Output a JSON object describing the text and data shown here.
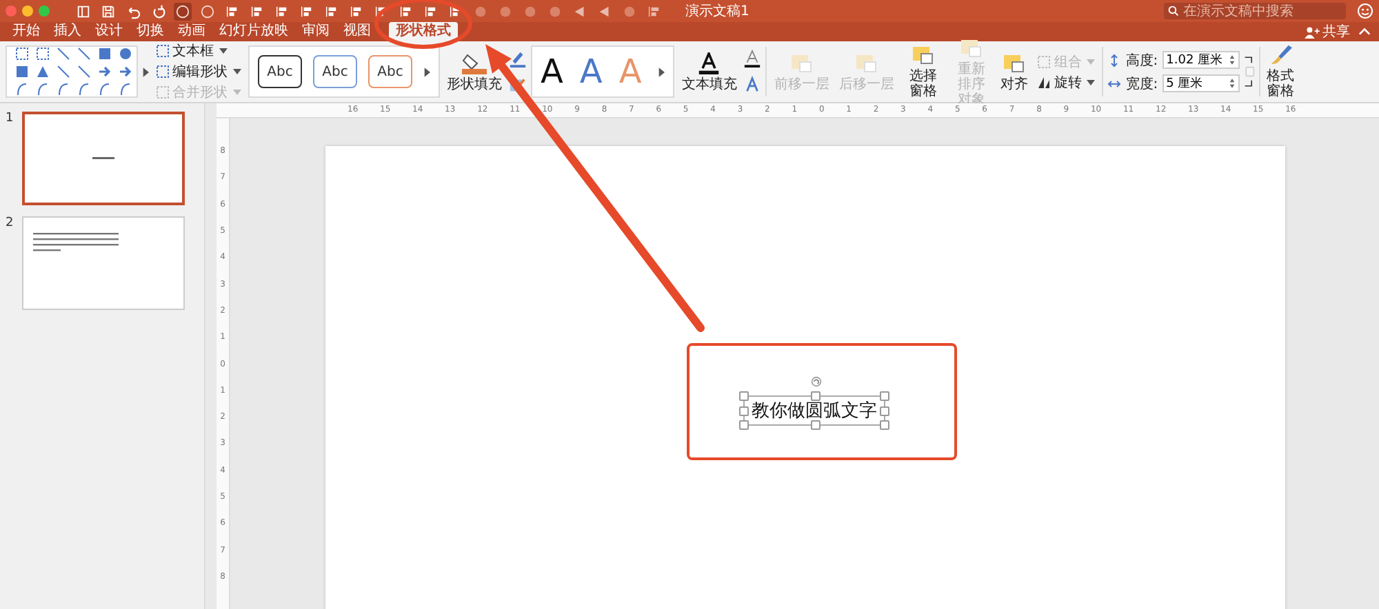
{
  "window": {
    "title": "演示文稿1"
  },
  "search": {
    "placeholder": "在演示文稿中搜索"
  },
  "share_button": "共享",
  "tabs": [
    {
      "label": "开始",
      "selected": false
    },
    {
      "label": "插入",
      "selected": false
    },
    {
      "label": "设计",
      "selected": false
    },
    {
      "label": "切换",
      "selected": false
    },
    {
      "label": "动画",
      "selected": false
    },
    {
      "label": "幻灯片放映",
      "selected": false
    },
    {
      "label": "审阅",
      "selected": false
    },
    {
      "label": "视图",
      "selected": false
    },
    {
      "label": "形状格式",
      "selected": true
    }
  ],
  "ribbon": {
    "insert_commands": [
      {
        "label": "文本框",
        "disabled": false
      },
      {
        "label": "编辑形状",
        "disabled": false
      },
      {
        "label": "合并形状",
        "disabled": true
      }
    ],
    "shape_styles": [
      {
        "label": "Abc",
        "color": "#333333"
      },
      {
        "label": "Abc",
        "color": "#7a9fd8"
      },
      {
        "label": "Abc",
        "color": "#e8956b"
      }
    ],
    "shape_fill": "形状填充",
    "wordart_styles": [
      {
        "label": "A",
        "color": "#111111"
      },
      {
        "label": "A",
        "color": "#4a78c8"
      },
      {
        "label": "A",
        "color": "#e8956b"
      }
    ],
    "text_fill": "文本填充",
    "arrange": [
      {
        "label": "前移一层",
        "disabled": true
      },
      {
        "label": "后移一层",
        "disabled": true
      },
      {
        "label": "选择窗格",
        "disabled": false
      },
      {
        "label": "重新排序对象",
        "disabled": true
      },
      {
        "label": "对齐",
        "disabled": false
      }
    ],
    "group": {
      "label": "组合",
      "disabled": true
    },
    "rotate": {
      "label": "旋转",
      "disabled": false
    },
    "size": [
      {
        "label": "高度:",
        "value": "1.02 厘米"
      },
      {
        "label": "宽度:",
        "value": "5 厘米"
      }
    ],
    "format_pane": "格式窗格"
  },
  "ruler_labels": [
    "16",
    "15",
    "14",
    "13",
    "12",
    "11",
    "10",
    "9",
    "8",
    "7",
    "6",
    "5",
    "4",
    "3",
    "2",
    "1",
    "0",
    "1",
    "2",
    "3",
    "4",
    "5",
    "6",
    "7",
    "8",
    "9",
    "10",
    "11",
    "12",
    "13",
    "14",
    "15",
    "16"
  ],
  "vertical_ruler_labels": [
    "8",
    "7",
    "6",
    "5",
    "4",
    "3",
    "2",
    "1",
    "0",
    "1",
    "2",
    "3",
    "4",
    "5",
    "6",
    "7",
    "8"
  ],
  "slides": [
    {
      "number": "1",
      "selected": true,
      "kind": "title"
    },
    {
      "number": "2",
      "selected": false,
      "kind": "text"
    }
  ],
  "slide": {
    "text": "教你做圆弧文字"
  }
}
